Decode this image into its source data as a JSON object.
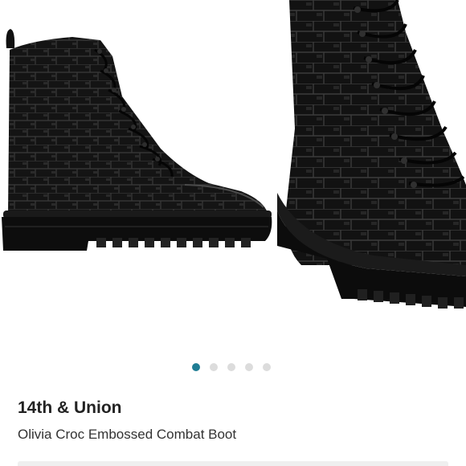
{
  "product": {
    "brand": "14th & Union",
    "name": "Olivia Croc Embossed Combat Boot"
  },
  "carousel": {
    "total_images": 5,
    "active_index": 0,
    "active_color": "#1f7d94",
    "inactive_color": "#dcdcdc"
  }
}
